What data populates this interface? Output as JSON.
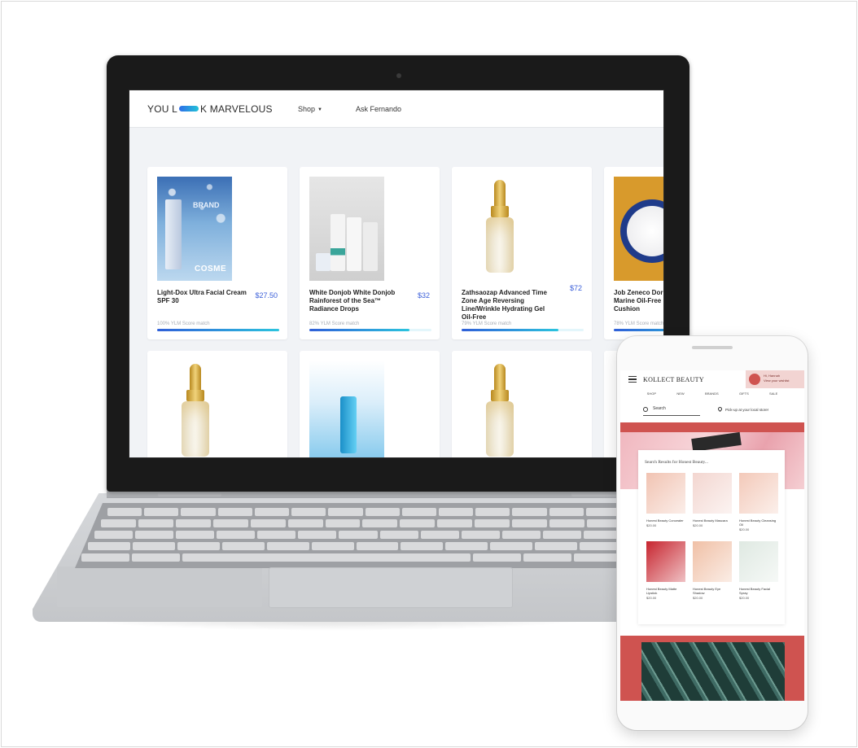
{
  "laptop_app": {
    "logo": {
      "left": "YOU L",
      "right": "K MARVELOUS"
    },
    "nav": {
      "shop": "Shop",
      "ask": "Ask Fernando"
    },
    "products": [
      {
        "name": "Light-Dox Ultra Facial Cream SPF 30",
        "price": "$27.50",
        "match_text": "100% YLM Score match",
        "match": 1.0,
        "art_brand": "BRAND",
        "art_label": "COSME"
      },
      {
        "name": "White Donjob White Donjob Rainforest of the Sea™ Radiance Drops",
        "price": "$32",
        "match_text": "82% YLM Score match",
        "match": 0.82
      },
      {
        "name": "Zathsaozap Advanced Time Zone Age Reversing Line/Wrinkle Hydrating Gel Oil-Free",
        "price": "$72",
        "match_text": "79% YLM Score match",
        "match": 0.79
      },
      {
        "name": "Job Zeneco Dor Marine Oil-Free Cushion",
        "price": "",
        "match_text": "78% YLM Score match",
        "match": 0.78
      }
    ]
  },
  "phone_app": {
    "logo": "KOLLECT BEAUTY",
    "user": {
      "name": "Hi, Hannah",
      "sub": "View your wishlist"
    },
    "nav": [
      "SHOP",
      "NEW",
      "BRANDS",
      "GIFTS",
      "SALE"
    ],
    "search_label": "Search",
    "pickup_label": "Pick-up at your local store!",
    "results_title": "Search Results for Honest Beauty...",
    "results": [
      {
        "name": "Honest Beauty Concealer",
        "price": "$20.00",
        "color": "#f1c3b2"
      },
      {
        "name": "Honest Beauty Mascara",
        "price": "$20.00",
        "color": "#f3d6d0"
      },
      {
        "name": "Honest Beauty Cleansing Oil",
        "price": "$20.00",
        "color": "#f3c9b9"
      },
      {
        "name": "Honest Beauty Matte Lipstick",
        "price": "$20.00",
        "color": "#c7252f"
      },
      {
        "name": "Honest Beauty Eye Shadow",
        "price": "$20.00",
        "color": "#f0c0a6"
      },
      {
        "name": "Honest Beauty Facial Spray",
        "price": "$20.00",
        "color": "#dfe9e2"
      }
    ]
  },
  "colors": {
    "accent_blue": "#3b5fd9",
    "kollect_red": "#cf5350"
  }
}
